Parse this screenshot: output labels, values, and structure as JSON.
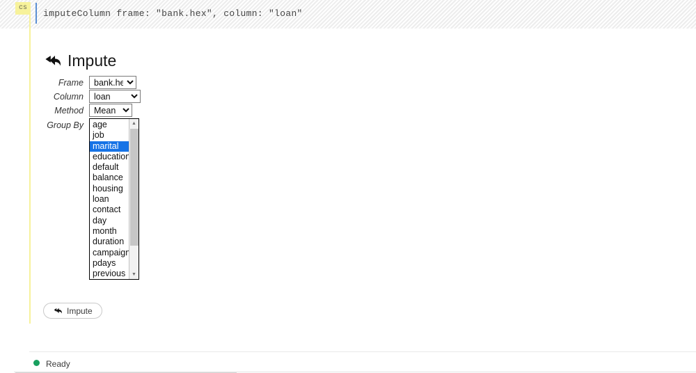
{
  "code_cell": {
    "tag_label": "cs",
    "code": "imputeColumn frame: \"bank.hex\", column: \"loan\""
  },
  "panel": {
    "heading": "Impute",
    "heading_icon": "reply-all-arrow-icon",
    "form": {
      "frame": {
        "label": "Frame",
        "value": "bank.hex",
        "options": [
          "bank.hex"
        ]
      },
      "column": {
        "label": "Column",
        "value": "loan",
        "options": [
          "loan"
        ]
      },
      "method": {
        "label": "Method",
        "value": "Mean",
        "options": [
          "Mean"
        ]
      },
      "group_by": {
        "label": "Group By",
        "selected": [
          "marital"
        ],
        "options": [
          "age",
          "job",
          "marital",
          "education",
          "default",
          "balance",
          "housing",
          "loan",
          "contact",
          "day",
          "month",
          "duration",
          "campaign",
          "pdays",
          "previous"
        ]
      }
    },
    "submit_button": {
      "label": "Impute",
      "icon": "reply-all-arrow-icon"
    }
  },
  "status_bar": {
    "text": "Ready",
    "indicator": "green-dot",
    "indicator_color": "#18a05f"
  },
  "colors": {
    "tag_yellow": "#f7f29b",
    "selection_blue": "#1673e6",
    "caret_blue": "#5b8fd4",
    "status_green": "#18a05f"
  }
}
